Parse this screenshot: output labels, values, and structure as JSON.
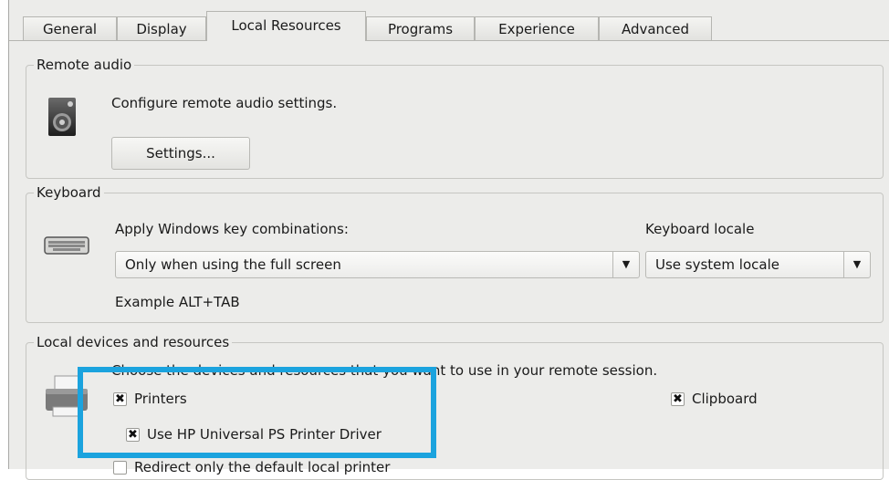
{
  "tabs": [
    {
      "label": "General"
    },
    {
      "label": "Display"
    },
    {
      "label": "Local Resources"
    },
    {
      "label": "Programs"
    },
    {
      "label": "Experience"
    },
    {
      "label": "Advanced"
    }
  ],
  "remote_audio": {
    "legend": "Remote audio",
    "description": "Configure remote audio settings.",
    "settings_button": "Settings..."
  },
  "keyboard": {
    "legend": "Keyboard",
    "apply_label": "Apply Windows key combinations:",
    "apply_value": "Only when using the full screen",
    "locale_label": "Keyboard locale",
    "locale_value": "Use system locale",
    "example": "Example ALT+TAB"
  },
  "local_devices": {
    "legend": "Local devices and resources",
    "description": "Choose the devices and resources that you want to use in your remote session.",
    "printers_label": "Printers",
    "printers_checked": true,
    "hp_driver_label": "Use HP Universal PS Printer Driver",
    "hp_driver_checked": true,
    "clipboard_label": "Clipboard",
    "clipboard_checked": true,
    "default_printer_label": "Redirect only the default local printer",
    "default_printer_checked": false
  },
  "colors": {
    "highlight": "#1ba3de",
    "window_bg": "#ececea"
  },
  "icons": [
    "speaker-icon",
    "keyboard-icon",
    "printer-icon",
    "dropdown-arrow-icon",
    "check-mark-icon"
  ]
}
